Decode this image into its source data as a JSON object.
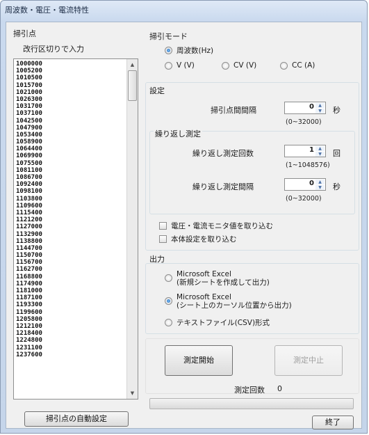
{
  "window": {
    "title": "周波数・電圧・電流特性"
  },
  "sweep_points": {
    "group_title": "掃引点",
    "hint": "改行区切りで入力",
    "items": [
      "1000000",
      "1005200",
      "1010500",
      "1015700",
      "1021000",
      "1026300",
      "1031700",
      "1037100",
      "1042500",
      "1047900",
      "1053400",
      "1058900",
      "1064400",
      "1069900",
      "1075500",
      "1081100",
      "1086700",
      "1092400",
      "1098100",
      "1103800",
      "1109600",
      "1115400",
      "1121200",
      "1127000",
      "1132900",
      "1138800",
      "1144700",
      "1150700",
      "1156700",
      "1162700",
      "1168800",
      "1174900",
      "1181000",
      "1187100",
      "1193300",
      "1199600",
      "1205800",
      "1212100",
      "1218400",
      "1224800",
      "1231100",
      "1237600"
    ],
    "auto_button": "掃引点の自動設定"
  },
  "sweep_mode": {
    "title": "掃引モード",
    "frequency": "周波数(Hz)",
    "v": "V (V)",
    "cv": "CV (V)",
    "cc": "CC (A)"
  },
  "settings": {
    "title": "設定",
    "interval_label": "掃引点間間隔",
    "interval_value": "0",
    "interval_unit": "秒",
    "interval_range": "(0~32000)",
    "repeat_title": "繰り返し測定",
    "repeat_count_label": "繰り返し測定回数",
    "repeat_count_value": "1",
    "repeat_count_unit": "回",
    "repeat_count_range": "(1~1048576)",
    "repeat_interval_label": "繰り返し測定間隔",
    "repeat_interval_value": "0",
    "repeat_interval_unit": "秒",
    "repeat_interval_range": "(0~32000)",
    "check_monitor": "電圧・電流モニタ値を取り込む",
    "check_device": "本体設定を取り込む"
  },
  "output": {
    "title": "出力",
    "opt1_line1": "Microsoft Excel",
    "opt1_line2": "(新規シートを作成して出力)",
    "opt2_line1": "Microsoft Excel",
    "opt2_line2": "(シート上のカーソル位置から出力)",
    "opt3": "テキストファイル(CSV)形式"
  },
  "actions": {
    "start": "測定開始",
    "stop": "測定中止",
    "count_label": "測定回数",
    "count_value": "0",
    "exit": "終了"
  },
  "progress": 0
}
